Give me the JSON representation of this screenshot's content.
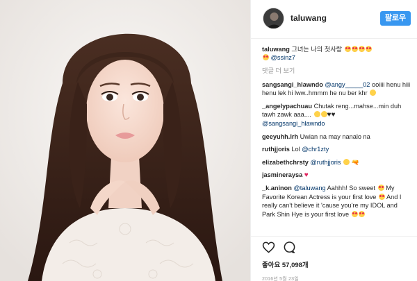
{
  "header": {
    "username": "taluwang",
    "follow_label": "팔로우"
  },
  "caption": {
    "user": "taluwang",
    "text": "그녀는 나의 첫사랑",
    "mention": "@ssinz7"
  },
  "more_comments": "댓글 더 보기",
  "comments": [
    {
      "user": "sangsangi_hlawndo",
      "mention": "@angy_____02",
      "text": " ooiiii henu hiii henu lek hi lww..hmmm he nu ber khr"
    },
    {
      "user": "_angelypachuau",
      "mention": "",
      "text": "Chutak reng...mahse...min duh tawh zawk aaa....",
      "mention2": "@sangsangi_hlawndo"
    },
    {
      "user": "geeyuhh.lrh",
      "mention": "",
      "text": "Uwian na may nanalo na"
    },
    {
      "user": "ruthjjoris",
      "mention": "",
      "text": "Lol ",
      "mention2": "@chr1zty"
    },
    {
      "user": "elizabethchrsty",
      "mention": "@ruthjjoris",
      "text": ""
    },
    {
      "user": "jasmineraysa",
      "mention": "",
      "text": ""
    },
    {
      "user": "_k.aninon",
      "mention": "@taluwang",
      "text": " Aahhh! So sweet",
      "text2": "My Favorite Korean Actress is your first love",
      "text3": "And I really can't believe it 'cause you're my IDOL and Park Shin Hye is your first love"
    }
  ],
  "icons": {
    "like": "heart-outline-icon",
    "comment": "speech-bubble-icon"
  },
  "likes_label": "좋아요 57,098개",
  "date": "2016년 5월 23일"
}
